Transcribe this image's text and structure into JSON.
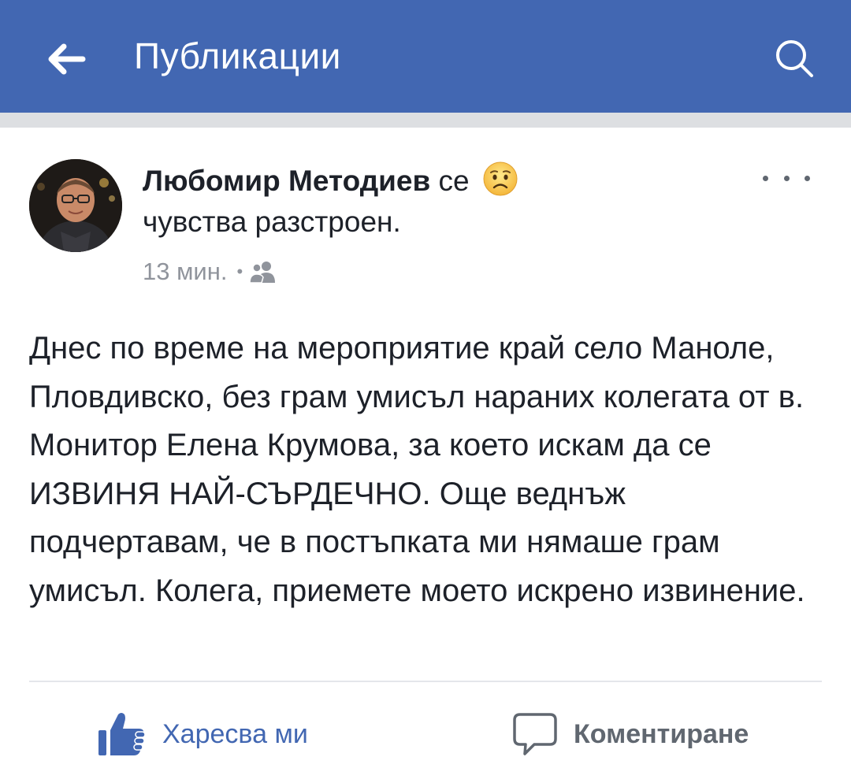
{
  "topbar": {
    "title": "Публикации",
    "back_icon": "arrow-left-icon",
    "search_icon": "search-icon",
    "bg_color": "#4267b2"
  },
  "post": {
    "author": "Любомир Методиев",
    "feeling_prefix": "се",
    "feeling_emoji": "sad-face-emoji",
    "feeling_text": "чувства разстроен.",
    "time": "13 мин.",
    "audience_icon": "friends-icon",
    "more_icon": "more-dots-icon",
    "body": "Днес по време на мероприятие край село Маноле, Пловдивско, без грам умисъл нараних колегата от в. Монитор Елена Крумова, за което искам да се ИЗВИНЯ НАЙ-СЪРДЕЧНО. Още веднъж подчертавам, че в постъпката ми нямаше грам умисъл. Колега, приемете моето искрено извинение."
  },
  "actions": {
    "like_label": "Харесва ми",
    "like_icon": "thumbs-up-icon",
    "comment_label": "Коментиране",
    "comment_icon": "comment-bubble-icon"
  }
}
